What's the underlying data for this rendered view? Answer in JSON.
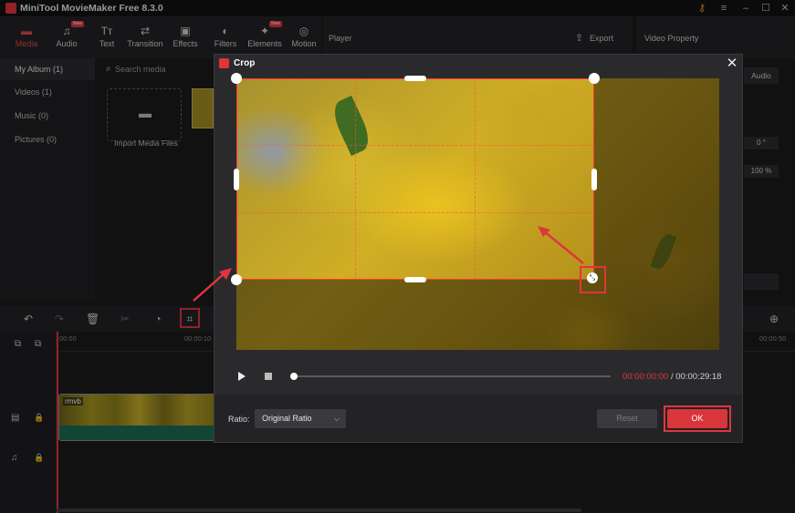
{
  "app": {
    "title": "MiniTool MovieMaker Free 8.3.0"
  },
  "toolbar": {
    "items": [
      {
        "label": "Media",
        "icon": "folder-icon",
        "active": true
      },
      {
        "label": "Audio",
        "icon": "music-icon",
        "badge": "New"
      },
      {
        "label": "Text",
        "icon": "text-icon"
      },
      {
        "label": "Transition",
        "icon": "transition-icon"
      },
      {
        "label": "Effects",
        "icon": "effects-icon"
      },
      {
        "label": "Filters",
        "icon": "filters-icon"
      },
      {
        "label": "Elements",
        "icon": "elements-icon",
        "badge": "New"
      },
      {
        "label": "Motion",
        "icon": "motion-icon"
      }
    ]
  },
  "player": {
    "label": "Player",
    "export_label": "Export"
  },
  "property": {
    "label": "Video Property",
    "audio_tab": "Audio",
    "rotation_value": "0 °",
    "zoom_value": "100 %"
  },
  "album": {
    "items": [
      {
        "label": "My Album (1)"
      },
      {
        "label": "Videos (1)"
      },
      {
        "label": "Music (0)"
      },
      {
        "label": "Pictures (0)"
      }
    ]
  },
  "media": {
    "search_placeholder": "Search media",
    "import_label": "Import Media Files"
  },
  "timeline": {
    "time_start": "00:00",
    "time_mark": "00:00:10",
    "time_end": "00:00:50",
    "clip_name": "rmvb"
  },
  "crop_dialog": {
    "title": "Crop",
    "time_current": "00:00:00:00",
    "time_total": "/ 00:00:29:18",
    "ratio_label": "Ratio:",
    "ratio_value": "Original Ratio",
    "reset_label": "Reset",
    "ok_label": "OK"
  },
  "colors": {
    "accent": "#e0353c",
    "crop_border": "#ff3b30",
    "ok_button": "#d8363b"
  }
}
